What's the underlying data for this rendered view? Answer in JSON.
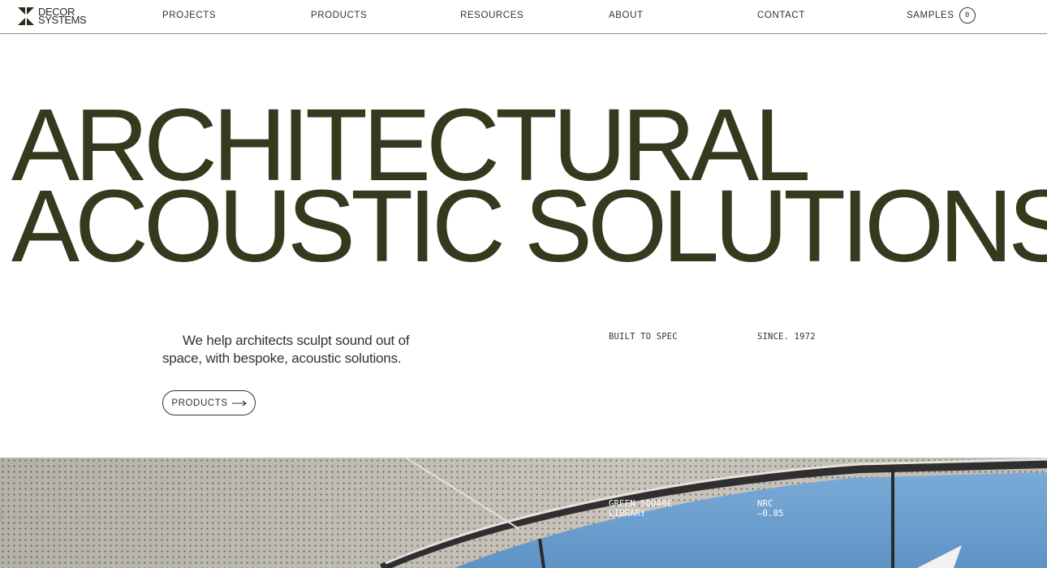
{
  "brand": {
    "line1": "DECOR",
    "line2": "SYSTEMS"
  },
  "nav": {
    "items": [
      {
        "label": "PROJECTS"
      },
      {
        "label": "PRODUCTS"
      },
      {
        "label": "RESOURCES"
      },
      {
        "label": "ABOUT"
      },
      {
        "label": "CONTACT"
      }
    ],
    "samples_label": "SAMPLES",
    "samples_count": "0"
  },
  "hero": {
    "line1": "ARCHITECTURAL",
    "line2": "ACOUSTIC SOLUTIONS",
    "intro": "We help architects sculpt sound out of space, with bespoke, acoustic solutions.",
    "cta_label": "PRODUCTS",
    "tag_left": "BUILT TO SPEC",
    "tag_right": "SINCE. 1972"
  },
  "feature": {
    "project_name": "GREEN SQUARE LIBRARY",
    "metric_label": "NRC",
    "metric_value": "—0.85"
  },
  "colors": {
    "hero_text": "#37391f",
    "body_text": "#33332a",
    "sky": "#6ea0cf"
  }
}
